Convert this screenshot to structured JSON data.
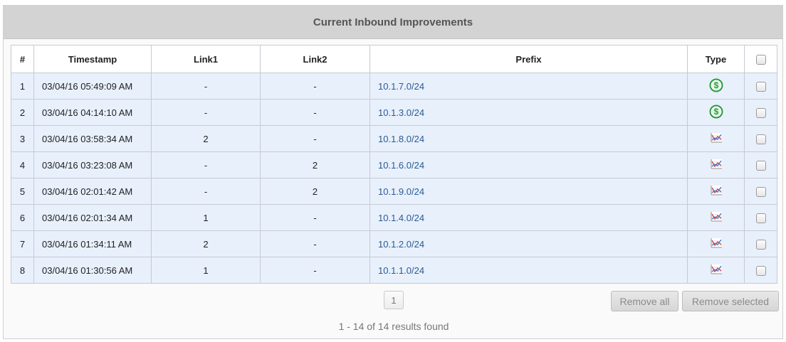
{
  "panel": {
    "title": "Current Inbound Improvements"
  },
  "table": {
    "columns": [
      "#",
      "Timestamp",
      "Link1",
      "Link2",
      "Prefix",
      "Type"
    ],
    "rows": [
      {
        "num": "1",
        "timestamp": "03/04/16 05:49:09 AM",
        "link1": "-",
        "link2": "-",
        "prefix": "10.1.7.0/24",
        "type_icon": "dollar-icon"
      },
      {
        "num": "2",
        "timestamp": "03/04/16 04:14:10 AM",
        "link1": "-",
        "link2": "-",
        "prefix": "10.1.3.0/24",
        "type_icon": "dollar-icon"
      },
      {
        "num": "3",
        "timestamp": "03/04/16 03:58:34 AM",
        "link1": "2",
        "link2": "-",
        "prefix": "10.1.8.0/24",
        "type_icon": "performance-chart-icon"
      },
      {
        "num": "4",
        "timestamp": "03/04/16 03:23:08 AM",
        "link1": "-",
        "link2": "2",
        "prefix": "10.1.6.0/24",
        "type_icon": "performance-chart-icon"
      },
      {
        "num": "5",
        "timestamp": "03/04/16 02:01:42 AM",
        "link1": "-",
        "link2": "2",
        "prefix": "10.1.9.0/24",
        "type_icon": "performance-chart-icon"
      },
      {
        "num": "6",
        "timestamp": "03/04/16 02:01:34 AM",
        "link1": "1",
        "link2": "-",
        "prefix": "10.1.4.0/24",
        "type_icon": "performance-chart-icon"
      },
      {
        "num": "7",
        "timestamp": "03/04/16 01:34:11 AM",
        "link1": "2",
        "link2": "-",
        "prefix": "10.1.2.0/24",
        "type_icon": "performance-chart-icon"
      },
      {
        "num": "8",
        "timestamp": "03/04/16 01:30:56 AM",
        "link1": "1",
        "link2": "-",
        "prefix": "10.1.1.0/24",
        "type_icon": "performance-chart-icon"
      }
    ]
  },
  "pagination": {
    "current_page": "1"
  },
  "actions": {
    "remove_all": "Remove all",
    "remove_selected": "Remove selected"
  },
  "footer": {
    "results_text": "1 - 14 of 14 results found"
  },
  "colors": {
    "header_bg": "#d3d3d3",
    "row_bg": "#e8f0fc",
    "link": "#2a5a94",
    "dollar_icon": "#2e9b3e"
  }
}
